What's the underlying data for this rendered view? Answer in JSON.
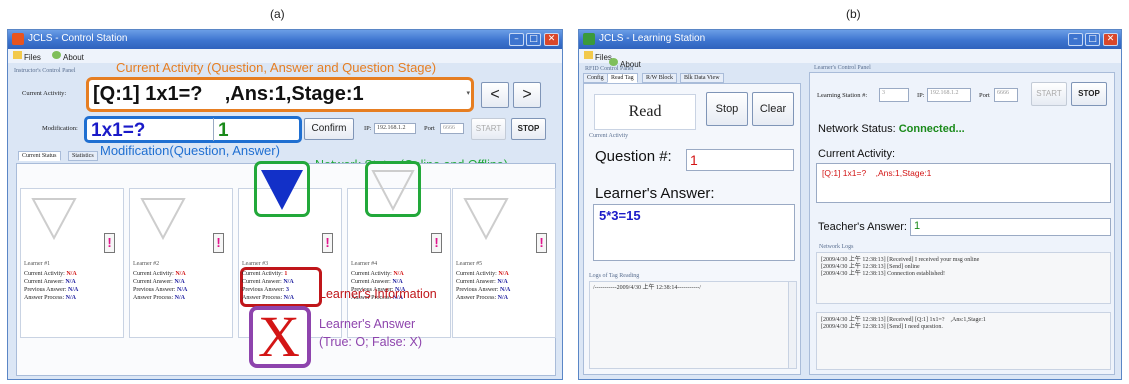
{
  "captions": {
    "left": "(a)",
    "right": "(b)"
  },
  "control": {
    "title": "JCLS - Control Station",
    "menu": {
      "files": "Files",
      "about": "About"
    },
    "group_title": "Instructor's Control Panel",
    "current_activity_label": "Current Activity:",
    "current_activity_value": "[Q:1] 1x1=?    ,Ans:1,Stage:1",
    "prev_label": "<",
    "next_label": ">",
    "modification_label": "Modification:",
    "mod_question": "1x1=?",
    "mod_answer": "1",
    "confirm_label": "Confirm",
    "ip_label": "IP:",
    "ip_value": "192.168.1.2",
    "port_label": "Port",
    "port_value": "6666",
    "start_label": "START",
    "stop_label": "STOP",
    "tabs": [
      "Current Status",
      "Statistics"
    ],
    "annotations": {
      "current_activity": "Current Activity (Question, Answer and Question Stage)",
      "modification": "Modification(Question, Answer)",
      "network_status": "Network Status(Online and Offline)",
      "learners_information": "Learner's Information",
      "learners_answer_title": "Learner's Answer",
      "learners_answer_sub": "(True: O; False: X)",
      "x_mark": "X"
    },
    "learners": [
      {
        "name": "Learner #1",
        "activity": "N/A",
        "answer": "N/A",
        "previous": "N/A",
        "process": "N/A"
      },
      {
        "name": "Learner #2",
        "activity": "N/A",
        "answer": "N/A",
        "previous": "N/A",
        "process": "N/A"
      },
      {
        "name": "Learner #3",
        "activity": "1",
        "answer": "N/A",
        "previous": "3",
        "process": "N/A"
      },
      {
        "name": "Learner #4",
        "activity": "N/A",
        "answer": "N/A",
        "previous": "N/A",
        "process": "N/A"
      },
      {
        "name": "Learner #5",
        "activity": "N/A",
        "answer": "N/A",
        "previous": "N/A",
        "process": "N/A"
      }
    ],
    "row_labels": {
      "activity": "Current Activity:",
      "answer": "Current Answer:",
      "previous": "Previous Answer:",
      "process": "Answer Process:"
    },
    "warn_glyph": "!"
  },
  "learning": {
    "title": "JCLS - Learning Station",
    "menu": {
      "files": "Files",
      "about": "About"
    },
    "rfid_title": "RFID Control Panel",
    "tabs": [
      "Config",
      "Read Tag",
      "R/W Block",
      "Blk Data View"
    ],
    "read_label": "Read",
    "stop_btn": "Stop",
    "clear_btn": "Clear",
    "current_activity_group": "Current Activity",
    "question_label": "Question #:",
    "question_value": "1",
    "learners_answer_label": "Learner's Answer:",
    "learners_answer_value": "5*3=15",
    "logs_title": "Logs of Tag Reading",
    "tag_log": "/-----------2009/4/30 上午 12:38:14-----------/",
    "learner_panel_title": "Learner's Control Panel",
    "station_label": "Learning Station #:",
    "station_value": "3",
    "ip_label": "IP:",
    "ip_value": "192.168.1.2",
    "port_label": "Port",
    "port_value": "6666",
    "start_label": "START",
    "stop_label": "STOP",
    "network_label": "Network Status:",
    "network_value": "Connected...",
    "current_activity_label": "Current Activity:",
    "current_activity_value": "[Q:1] 1x1=?    ,Ans:1,Stage:1",
    "teachers_answer_label": "Teacher's Answer:",
    "teachers_answer_value": "1",
    "network_logs_title": "Network Logs",
    "logs1": [
      "[2009/4/30 上午 12:38:13] [Received] I received your msg online",
      "[2009/4/30 上午 12:38:13] [Send] online",
      "[2009/4/30 上午 12:38:13] Connection established!"
    ],
    "logs2": [
      "[2009/4/30 上午 12:38:13] [Received] [Q:1] 1x1=?    ,Ans:1,Stage:1",
      "[2009/4/30 上午 12:38:13] [Send] I need question."
    ]
  },
  "colors": {
    "annot_orange": "#e67e22",
    "annot_blue": "#1f6fd1",
    "annot_green": "#22a83a",
    "annot_red": "#c0161a",
    "annot_purple": "#8e44ad",
    "value_red": "#d31515",
    "value_blue": "#1a1ac8",
    "value_green": "#1a8a1a"
  }
}
